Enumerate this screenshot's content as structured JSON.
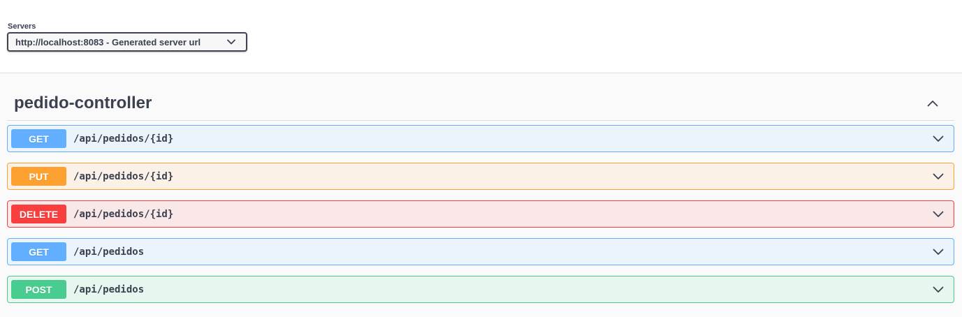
{
  "servers": {
    "label": "Servers",
    "selected": "http://localhost:8083 - Generated server url"
  },
  "tag": {
    "name": "pedido-controller",
    "toggle_icon": "chevron-up-icon"
  },
  "operations": [
    {
      "method": "GET",
      "path": "/api/pedidos/{id}",
      "bg": "#ebf3fb",
      "border": "#61affe",
      "badge": "#61affe"
    },
    {
      "method": "PUT",
      "path": "/api/pedidos/{id}",
      "bg": "#fbf1e6",
      "border": "#fca130",
      "badge": "#fca130"
    },
    {
      "method": "DELETE",
      "path": "/api/pedidos/{id}",
      "bg": "#fae7e7",
      "border": "#f93e3e",
      "badge": "#f93e3e"
    },
    {
      "method": "GET",
      "path": "/api/pedidos",
      "bg": "#ebf3fb",
      "border": "#61affe",
      "badge": "#61affe"
    },
    {
      "method": "POST",
      "path": "/api/pedidos",
      "bg": "#e8f6f0",
      "border": "#49cc90",
      "badge": "#49cc90"
    }
  ],
  "colors": {
    "text": "#3b4151",
    "page_bg": "#fafafa"
  }
}
